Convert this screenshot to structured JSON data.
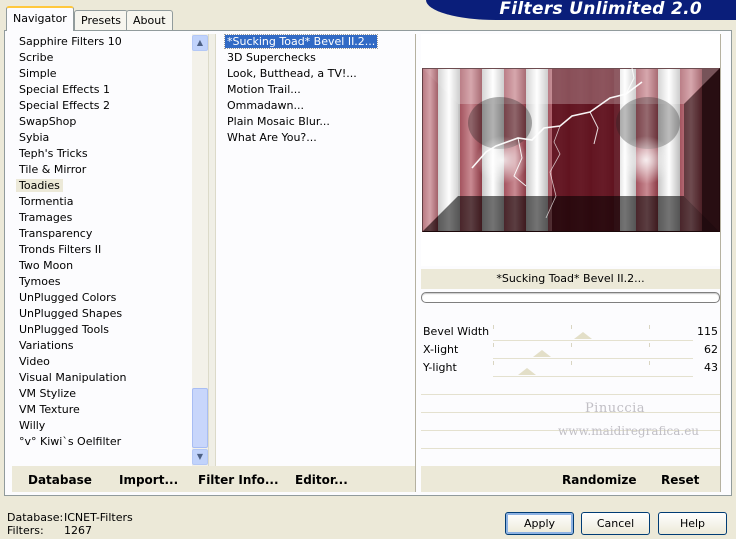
{
  "banner": {
    "title": "Filters Unlimited 2.0"
  },
  "tabs": {
    "navigator": "Navigator",
    "presets": "Presets",
    "about": "About"
  },
  "categories": [
    "Sapphire Filters 10",
    "Scribe",
    "Simple",
    "Special Effects 1",
    "Special Effects 2",
    "SwapShop",
    "Sybia",
    "Teph's Tricks",
    "Tile & Mirror",
    "Toadies",
    "Tormentia",
    "Tramages",
    "Transparency",
    "Tronds Filters II",
    "Two Moon",
    "Tymoes",
    "UnPlugged Colors",
    "UnPlugged Shapes",
    "UnPlugged Tools",
    "Variations",
    "Video",
    "Visual Manipulation",
    "VM Stylize",
    "VM Texture",
    "Willy",
    "°v° Kiwi`s Oelfilter"
  ],
  "selected_category": "Toadies",
  "effects": [
    "*Sucking Toad*  Bevel II.2...",
    "3D Superchecks",
    "Look, Butthead, a TV!...",
    "Motion Trail...",
    "Ommadawn...",
    "Plain Mosaic Blur...",
    "What Are You?..."
  ],
  "selected_effect": "*Sucking Toad*  Bevel II.2...",
  "preview": {
    "effect_name": "*Sucking Toad*  Bevel II.2..."
  },
  "params": [
    {
      "label": "Bevel Width",
      "value": "115",
      "level": 0.451
    },
    {
      "label": "X-light",
      "value": "62",
      "level": 0.243
    },
    {
      "label": "Y-light",
      "value": "43",
      "level": 0.169
    }
  ],
  "watermark": {
    "line1": "Pinuccia",
    "line2": "www.maidiregrafica.eu"
  },
  "toolbar": {
    "database": "Database",
    "import": "Import...",
    "filter_info": "Filter Info...",
    "editor": "Editor...",
    "randomize": "Randomize",
    "reset": "Reset"
  },
  "footer": {
    "database_label": "Database:",
    "database_value": "ICNET-Filters",
    "filters_label": "Filters:",
    "filters_value": "1267"
  },
  "buttons": {
    "apply": "Apply",
    "cancel": "Cancel",
    "help": "Help"
  },
  "colors": {
    "banner": "#0a1e7a",
    "selection": "#316ac5",
    "window_bg": "#ece9d8"
  }
}
